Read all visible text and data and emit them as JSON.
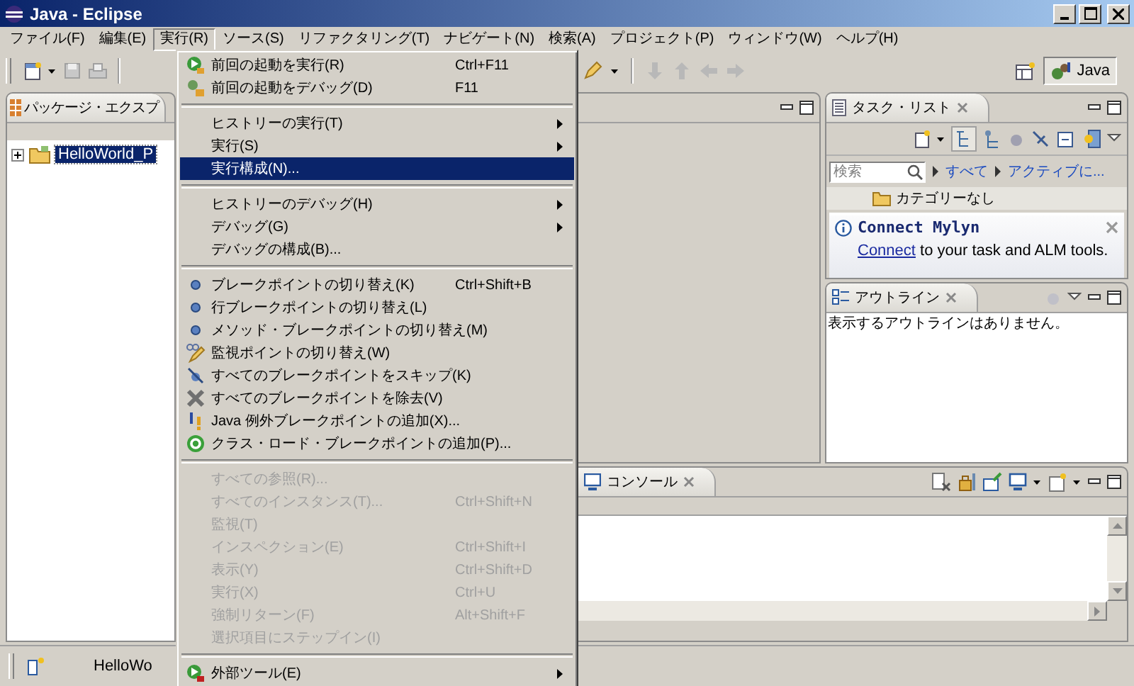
{
  "window": {
    "title": "Java - Eclipse"
  },
  "menu_bar": [
    {
      "label": "ファイル(F)",
      "selected": false
    },
    {
      "label": "編集(E)",
      "selected": false
    },
    {
      "label": "実行(R)",
      "selected": true
    },
    {
      "label": "ソース(S)",
      "selected": false
    },
    {
      "label": "リファクタリング(T)",
      "selected": false
    },
    {
      "label": "ナビゲート(N)",
      "selected": false
    },
    {
      "label": "検索(A)",
      "selected": false
    },
    {
      "label": "プロジェクト(P)",
      "selected": false
    },
    {
      "label": "ウィンドウ(W)",
      "selected": false
    },
    {
      "label": "ヘルプ(H)",
      "selected": false
    }
  ],
  "perspective": {
    "label": "Java",
    "selected": true
  },
  "package_explorer": {
    "tab": "パッケージ・エクスプ",
    "tree": [
      {
        "label": "HelloWorld_P",
        "expanded": false,
        "selected": true
      }
    ]
  },
  "task_list": {
    "tab": "タスク・リスト",
    "search": {
      "placeholder": "検索"
    },
    "filters": [
      "すべて",
      "アクティブに..."
    ],
    "category": "カテゴリーなし",
    "mylyn": {
      "title": "Connect Mylyn",
      "link": "Connect",
      "text": " to your task and ALM tools."
    }
  },
  "outline": {
    "tab": "アウトライン",
    "message": "表示するアウトラインはありません。"
  },
  "console": {
    "tab": "コンソール"
  },
  "status_bar": {
    "text": "HelloWo"
  },
  "run_menu": {
    "items": [
      {
        "kind": "item",
        "label": "前回の起動を実行(R)",
        "shortcut": "Ctrl+F11",
        "submenu": false,
        "disabled": false,
        "selected": false
      },
      {
        "kind": "item",
        "label": "前回の起動をデバッグ(D)",
        "shortcut": "F11",
        "submenu": false,
        "disabled": false,
        "selected": false
      },
      {
        "kind": "separator"
      },
      {
        "kind": "item",
        "label": "ヒストリーの実行(T)",
        "submenu": true,
        "disabled": false,
        "selected": false
      },
      {
        "kind": "item",
        "label": "実行(S)",
        "submenu": true,
        "disabled": false,
        "selected": false
      },
      {
        "kind": "item",
        "label": "実行構成(N)...",
        "submenu": false,
        "disabled": false,
        "selected": true
      },
      {
        "kind": "separator"
      },
      {
        "kind": "item",
        "label": "ヒストリーのデバッグ(H)",
        "submenu": true,
        "disabled": false,
        "selected": false
      },
      {
        "kind": "item",
        "label": "デバッグ(G)",
        "submenu": true,
        "disabled": false,
        "selected": false
      },
      {
        "kind": "item",
        "label": "デバッグの構成(B)...",
        "submenu": false,
        "disabled": false,
        "selected": false
      },
      {
        "kind": "separator"
      },
      {
        "kind": "item",
        "label": "ブレークポイントの切り替え(K)",
        "shortcut": "Ctrl+Shift+B",
        "submenu": false,
        "disabled": false,
        "selected": false
      },
      {
        "kind": "item",
        "label": "行ブレークポイントの切り替え(L)",
        "submenu": false,
        "disabled": false,
        "selected": false
      },
      {
        "kind": "item",
        "label": "メソッド・ブレークポイントの切り替え(M)",
        "submenu": false,
        "disabled": false,
        "selected": false
      },
      {
        "kind": "item",
        "label": "監視ポイントの切り替え(W)",
        "submenu": false,
        "disabled": false,
        "selected": false
      },
      {
        "kind": "item",
        "label": "すべてのブレークポイントをスキップ(K)",
        "submenu": false,
        "disabled": false,
        "selected": false
      },
      {
        "kind": "item",
        "label": "すべてのブレークポイントを除去(V)",
        "submenu": false,
        "disabled": false,
        "selected": false
      },
      {
        "kind": "item",
        "label": "Java 例外ブレークポイントの追加(X)...",
        "submenu": false,
        "disabled": false,
        "selected": false
      },
      {
        "kind": "item",
        "label": "クラス・ロード・ブレークポイントの追加(P)...",
        "submenu": false,
        "disabled": false,
        "selected": false
      },
      {
        "kind": "separator"
      },
      {
        "kind": "item",
        "label": "すべての参照(R)...",
        "submenu": false,
        "disabled": true,
        "selected": false
      },
      {
        "kind": "item",
        "label": "すべてのインスタンス(T)...",
        "shortcut": "Ctrl+Shift+N",
        "submenu": false,
        "disabled": true,
        "selected": false
      },
      {
        "kind": "item",
        "label": "監視(T)",
        "submenu": false,
        "disabled": true,
        "selected": false
      },
      {
        "kind": "item",
        "label": "インスペクション(E)",
        "shortcut": "Ctrl+Shift+I",
        "submenu": false,
        "disabled": true,
        "selected": false
      },
      {
        "kind": "item",
        "label": "表示(Y)",
        "shortcut": "Ctrl+Shift+D",
        "submenu": false,
        "disabled": true,
        "selected": false
      },
      {
        "kind": "item",
        "label": "実行(X)",
        "shortcut": "Ctrl+U",
        "submenu": false,
        "disabled": true,
        "selected": false
      },
      {
        "kind": "item",
        "label": "強制リターン(F)",
        "shortcut": "Alt+Shift+F",
        "submenu": false,
        "disabled": true,
        "selected": false
      },
      {
        "kind": "item",
        "label": "選択項目にステップイン(I)",
        "submenu": false,
        "disabled": true,
        "selected": false
      },
      {
        "kind": "separator"
      },
      {
        "kind": "item",
        "label": "外部ツール(E)",
        "submenu": true,
        "disabled": false,
        "selected": false
      }
    ]
  }
}
